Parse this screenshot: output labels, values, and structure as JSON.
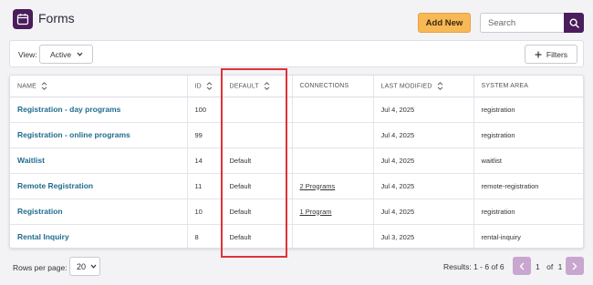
{
  "header": {
    "title": "Forms",
    "add_new_label": "Add New",
    "search_placeholder": "Search"
  },
  "toolbar": {
    "view_label": "View:",
    "view_value": "Active",
    "filters_label": "Filters"
  },
  "table": {
    "columns": [
      "NAME",
      "ID",
      "DEFAULT",
      "CONNECTIONS",
      "LAST MODIFIED",
      "SYSTEM AREA"
    ],
    "rows": [
      {
        "name": "Registration - day programs",
        "id": "100",
        "default": "",
        "connections": "",
        "modified": "Jul 4, 2025",
        "area": "registration"
      },
      {
        "name": "Registration - online programs",
        "id": "99",
        "default": "",
        "connections": "",
        "modified": "Jul 4, 2025",
        "area": "registration"
      },
      {
        "name": "Waitlist",
        "id": "14",
        "default": "Default",
        "connections": "",
        "modified": "Jul 4, 2025",
        "area": "waitlist"
      },
      {
        "name": "Remote Registration",
        "id": "11",
        "default": "Default",
        "connections": "2 Programs",
        "modified": "Jul 4, 2025",
        "area": "remote-registration"
      },
      {
        "name": "Registration",
        "id": "10",
        "default": "Default",
        "connections": "1 Program",
        "modified": "Jul 4, 2025",
        "area": "registration"
      },
      {
        "name": "Rental Inquiry",
        "id": "8",
        "default": "Default",
        "connections": "",
        "modified": "Jul 3, 2025",
        "area": "rental-inquiry"
      }
    ]
  },
  "footer": {
    "rows_per_page_label": "Rows per page:",
    "rows_per_page_value": "20",
    "results_text": "Results: 1 - 6 of 6",
    "page_current": "1",
    "page_of_label": "of",
    "page_total": "1"
  },
  "colors": {
    "brand": "#4b1d5c",
    "accent": "#f7b955",
    "link": "#1f6c8e",
    "highlight": "#e0323a"
  }
}
